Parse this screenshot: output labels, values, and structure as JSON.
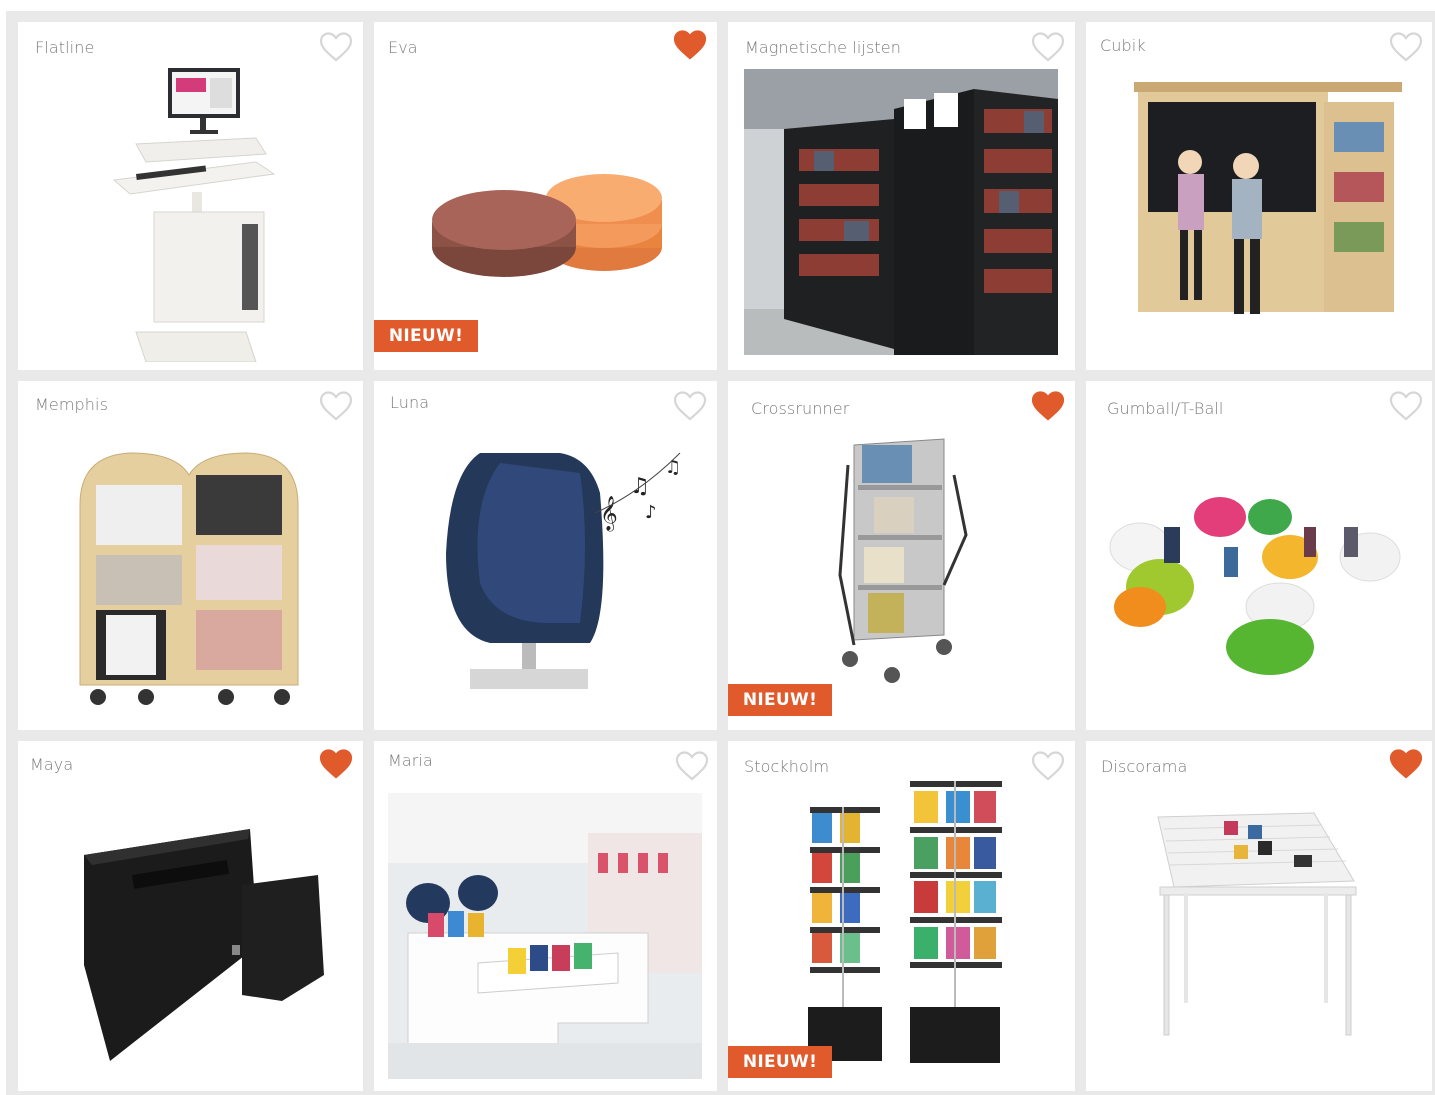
{
  "colors": {
    "accent": "#e05a2b",
    "heart_empty": "#d6d6d6",
    "heart_filled": "#e05a2b",
    "title": "#7b7b7b",
    "grid_bg": "#e9e9e9"
  },
  "products": [
    {
      "name": "Flatline",
      "favorite": false,
      "badge": null,
      "icon": "computer-kiosk-icon"
    },
    {
      "name": "Eva",
      "favorite": true,
      "badge": "NIEUW!",
      "icon": "round-cushions-icon"
    },
    {
      "name": "Magnetische lijsten",
      "favorite": false,
      "badge": null,
      "icon": "library-shelves-photo"
    },
    {
      "name": "Cubik",
      "favorite": false,
      "badge": null,
      "icon": "children-chalkboard-photo"
    },
    {
      "name": "Memphis",
      "favorite": false,
      "badge": null,
      "icon": "magazine-rack-icon"
    },
    {
      "name": "Luna",
      "favorite": false,
      "badge": null,
      "icon": "hooded-chair-icon"
    },
    {
      "name": "Crossrunner",
      "favorite": true,
      "badge": "NIEUW!",
      "icon": "book-trolley-icon"
    },
    {
      "name": "Gumball/T-Ball",
      "favorite": false,
      "badge": null,
      "icon": "beanbags-photo"
    },
    {
      "name": "Maya",
      "favorite": true,
      "badge": null,
      "icon": "return-box-icon"
    },
    {
      "name": "Maria",
      "favorite": false,
      "badge": null,
      "icon": "library-display-photo"
    },
    {
      "name": "Stockholm",
      "favorite": false,
      "badge": "NIEUW!",
      "icon": "book-tower-icon"
    },
    {
      "name": "Discorama",
      "favorite": true,
      "badge": null,
      "icon": "cd-display-rack-icon"
    }
  ]
}
